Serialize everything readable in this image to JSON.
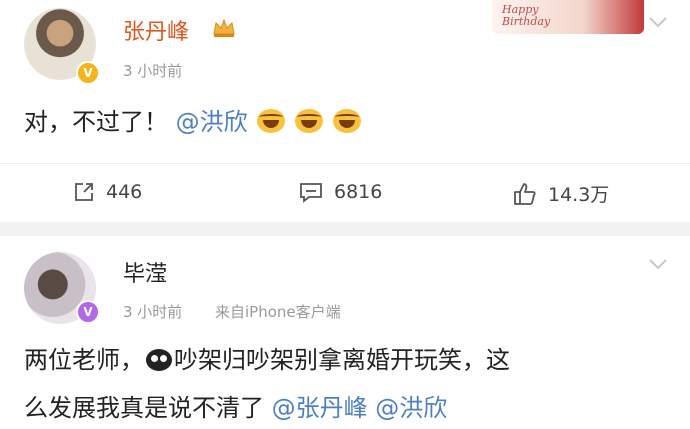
{
  "post1": {
    "username": "张丹峰",
    "time": "3 小时前",
    "badge": "V",
    "birthday_text_1": "Happy",
    "birthday_text_2": "Birthday",
    "text_main": "对，不过了！",
    "mention": "@洪欣",
    "actions": {
      "share_count": "446",
      "comment_count": "6816",
      "like_count": "14.3万"
    }
  },
  "post2": {
    "username": "毕滢",
    "time": "3 小时前",
    "source": "来自iPhone客户端",
    "badge": "V",
    "line1_a": "两位老师，",
    "line1_b": "吵架归吵架别拿离婚开玩笑，这",
    "line2_a": "么发展我真是说不清了",
    "mention1": "@张丹峰",
    "mention2": "@洪欣"
  },
  "colors": {
    "mention": "#4d7fc2",
    "name_highlight": "#e0581d",
    "meta": "#9a9a9a"
  }
}
